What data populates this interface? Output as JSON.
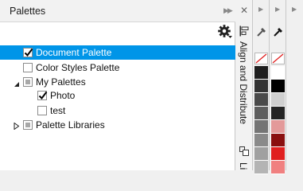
{
  "panel": {
    "title": "Palettes"
  },
  "tree": {
    "items": [
      {
        "label": "Document Palette",
        "checked": "checked",
        "selected": true
      },
      {
        "label": "Color Styles Palette",
        "checked": "unchecked",
        "selected": false
      },
      {
        "label": "My Palettes",
        "checked": "partial",
        "expander": "expanded",
        "selected": false
      },
      {
        "label": "Photo",
        "checked": "checked",
        "selected": false
      },
      {
        "label": "test",
        "checked": "unchecked",
        "selected": false
      },
      {
        "label": "Palette Libraries",
        "checked": "partial",
        "expander": "collapsed",
        "selected": false
      }
    ]
  },
  "side_tab": {
    "label": "Align and Distribute",
    "label2": "Li"
  },
  "palette_strip_1": {
    "swatches": [
      "none",
      "#1e1e1e",
      "#333333",
      "#4a4a4a",
      "#5e5e5e",
      "#757575",
      "#8a8a8a",
      "#a0a0a0",
      "#b4b4b4"
    ]
  },
  "palette_strip_2": {
    "swatches": [
      "none",
      "#ffffff",
      "#000000",
      "#cfcfcf",
      "#252525",
      "#e39a9a",
      "#8a0f0f",
      "#e02020",
      "#f08080"
    ]
  }
}
